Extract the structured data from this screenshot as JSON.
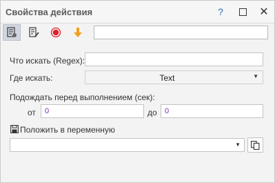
{
  "window": {
    "title": "Свойства действия",
    "help_label": "?",
    "close_label": "✕"
  },
  "toolbar": {
    "search_value": ""
  },
  "form": {
    "regex_label": "Что искать (Regex):",
    "regex_value": "",
    "where_label": "Где искать:",
    "where_value": "Text",
    "wait_label": "Подождать перед выполнением (сек):",
    "from_label": "от",
    "from_value": "0",
    "to_label": "до",
    "to_value": "0",
    "save_label": "Положить в переменную",
    "variable_value": ""
  },
  "colors": {
    "record": "#e0202a",
    "arrow": "#f0a020",
    "accent": "#2d6fb8"
  },
  "icons": [
    "properties-icon",
    "edit-icon",
    "record-icon",
    "arrow-down-icon",
    "save-icon",
    "copy-icon"
  ]
}
